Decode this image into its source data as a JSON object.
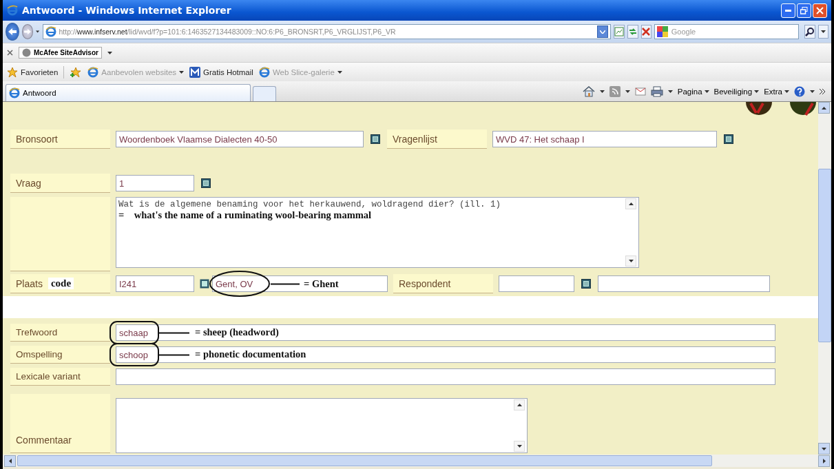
{
  "window": {
    "title": "Antwoord - Windows Internet Explorer"
  },
  "address_bar": {
    "url": "http://**www.infserv.net**/lid/wvd/f?p=101:6:1463527134483009::NO:6:P6_BRONSRT,P6_VRGLIJST,P6_VR"
  },
  "search": {
    "placeholder": "Google"
  },
  "addon_bar": {
    "label": "McAfee SiteAdvisor"
  },
  "favorites_bar": {
    "label": "Favorieten",
    "links": [
      {
        "label": "Aanbevolen websites",
        "disabled": true,
        "menu": true
      },
      {
        "label": "Gratis Hotmail",
        "disabled": false,
        "menu": false
      },
      {
        "label": "Web Slice-galerie",
        "disabled": true,
        "menu": true
      }
    ]
  },
  "tabs": [
    {
      "label": "Antwoord",
      "selected": true
    }
  ],
  "command_bar": [
    "Pagina",
    "Beveiliging",
    "Extra"
  ],
  "form": {
    "bronsoort": {
      "label": "Bronsoort",
      "value": "Woordenboek Vlaamse Dialecten 40-50"
    },
    "vragenlijst": {
      "label": "Vragenlijst",
      "value": "WVD 47: Het schaap I"
    },
    "vraag": {
      "label": "Vraag",
      "value": "1",
      "text": "Wat is de algemene benaming voor het herkauwend, woldragend dier? (ill. 1)"
    },
    "plaats": {
      "label": "Plaats",
      "code": "I241",
      "name": "Gent, OV"
    },
    "respondent": {
      "label": "Respondent"
    },
    "fields": [
      {
        "label": "Trefwoord",
        "value": "schaap"
      },
      {
        "label": "Omspelling",
        "value": "schoop"
      },
      {
        "label": "Lexicale variant"
      }
    ],
    "commentaar": {
      "label": "Commentaar"
    }
  },
  "annotations": {
    "question_gloss": "=    what's the name of a ruminating wool-bearing mammal",
    "plaats_code": "code",
    "place_gloss": "= Ghent",
    "field_glosses": [
      "= sheep (headword)",
      "= phonetic documentation"
    ]
  }
}
